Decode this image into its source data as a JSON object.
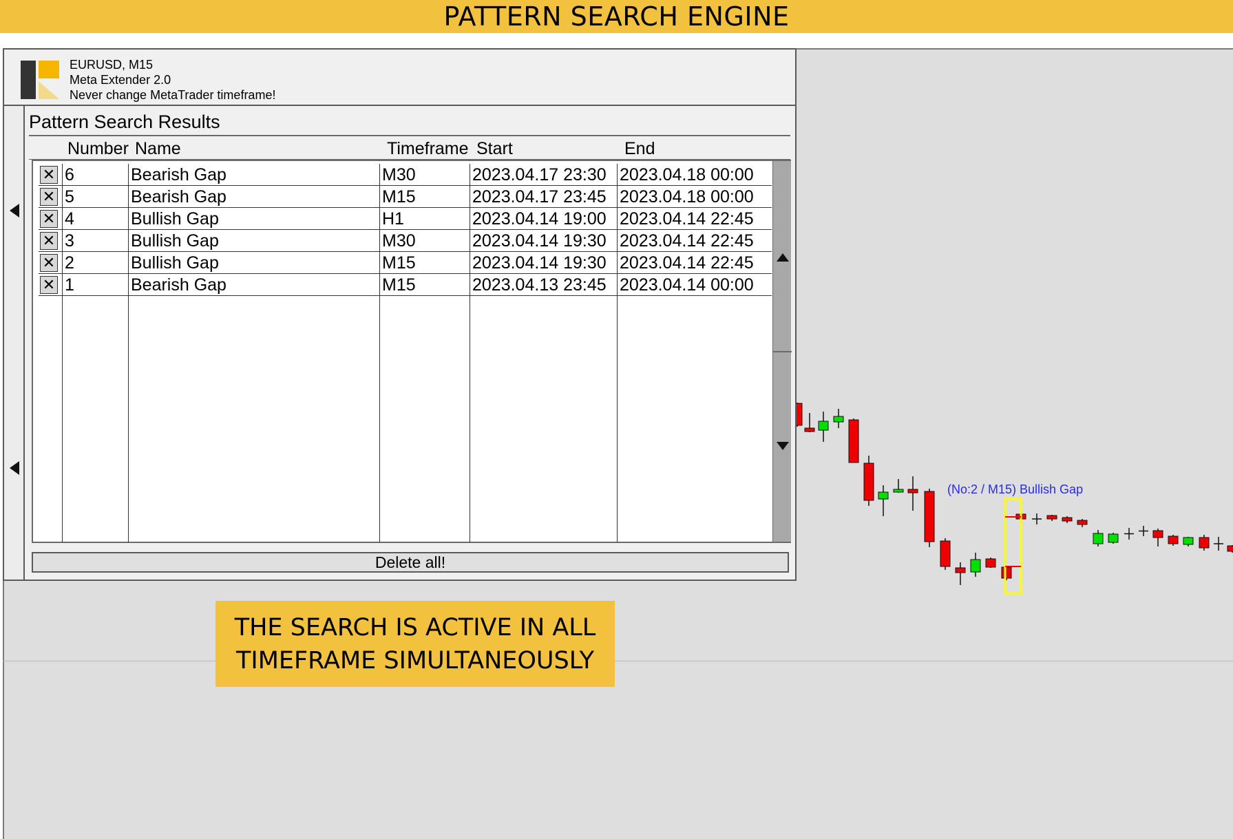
{
  "banner": {
    "title": "PATTERN SEARCH ENGINE"
  },
  "header": {
    "symbol": "EURUSD, M15",
    "product": "Meta Extender 2.0",
    "tagline": "Never change MetaTrader timeframe!"
  },
  "results": {
    "title": "Pattern Search Results",
    "columns": [
      "Number",
      "Name",
      "Timeframe",
      "Start",
      "End"
    ],
    "rows": [
      {
        "number": "6",
        "name": "Bearish Gap",
        "timeframe": "M30",
        "start": "2023.04.17 23:30",
        "end": "2023.04.18 00:00"
      },
      {
        "number": "5",
        "name": "Bearish Gap",
        "timeframe": "M15",
        "start": "2023.04.17 23:45",
        "end": "2023.04.18 00:00"
      },
      {
        "number": "4",
        "name": "Bullish Gap",
        "timeframe": "H1",
        "start": "2023.04.14 19:00",
        "end": "2023.04.14 22:45"
      },
      {
        "number": "3",
        "name": "Bullish Gap",
        "timeframe": "M30",
        "start": "2023.04.14 19:30",
        "end": "2023.04.14 22:45"
      },
      {
        "number": "2",
        "name": "Bullish Gap",
        "timeframe": "M15",
        "start": "2023.04.14 19:30",
        "end": "2023.04.14 22:45"
      },
      {
        "number": "1",
        "name": "Bearish Gap",
        "timeframe": "M15",
        "start": "2023.04.13 23:45",
        "end": "2023.04.14 00:00"
      }
    ],
    "delete_glyph": "✕",
    "delete_all_label": "Delete all!"
  },
  "chart": {
    "annotation": "(No:2 / M15) Bullish Gap",
    "colors": {
      "bull": "#00e000",
      "bear": "#ee0000",
      "highlight": "#ffff00",
      "annotation": "#2a2ae6"
    }
  },
  "callout": {
    "line1": "THE SEARCH IS ACTIVE IN ALL",
    "line2": "TIMEFRAME SIMULTANEOUSLY"
  },
  "colors": {
    "banner": "#f2c23e",
    "chart_bg": "#dedede"
  }
}
